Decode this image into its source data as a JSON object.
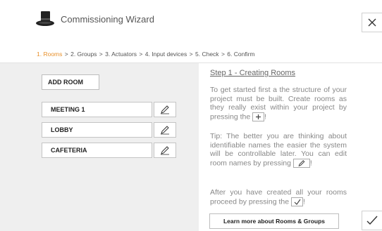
{
  "window": {
    "title": "Commissioning Wizard"
  },
  "breadcrumb": [
    {
      "label": "1. Rooms",
      "active": true
    },
    {
      "label": "2. Groups",
      "active": false
    },
    {
      "label": "3. Actuators",
      "active": false
    },
    {
      "label": "4. Input devices",
      "active": false
    },
    {
      "label": "5. Check",
      "active": false
    },
    {
      "label": "6. Confirm",
      "active": false
    }
  ],
  "breadcrumb_separator": ">",
  "left": {
    "add_room_label": "ADD ROOM",
    "rooms": [
      {
        "name": "MEETING 1"
      },
      {
        "name": "LOBBY"
      },
      {
        "name": "CAFETERIA"
      }
    ]
  },
  "help": {
    "title": "Step 1 - Creating Rooms",
    "p1": "To get started first a the structure of your project must be built. Create rooms as they really exist within your project by pressing the",
    "p1_end": "!",
    "p2": "Tip: The better you are thinking about identifiable names the easier the system will be controllable later. You can edit room names by pressing",
    "p2_end": "!",
    "p3": "After you have created all your rooms proceed by pressing the",
    "p3_end": "!",
    "learn_more_label": "Learn more about Rooms & Groups"
  },
  "icons": {
    "logo": "top-hat-icon",
    "close": "close-icon",
    "edit": "pencil-icon",
    "add": "plus-icon",
    "confirm": "checkmark-icon"
  },
  "colors": {
    "active_step": "#e8902a",
    "left_panel_bg": "#efefef"
  }
}
